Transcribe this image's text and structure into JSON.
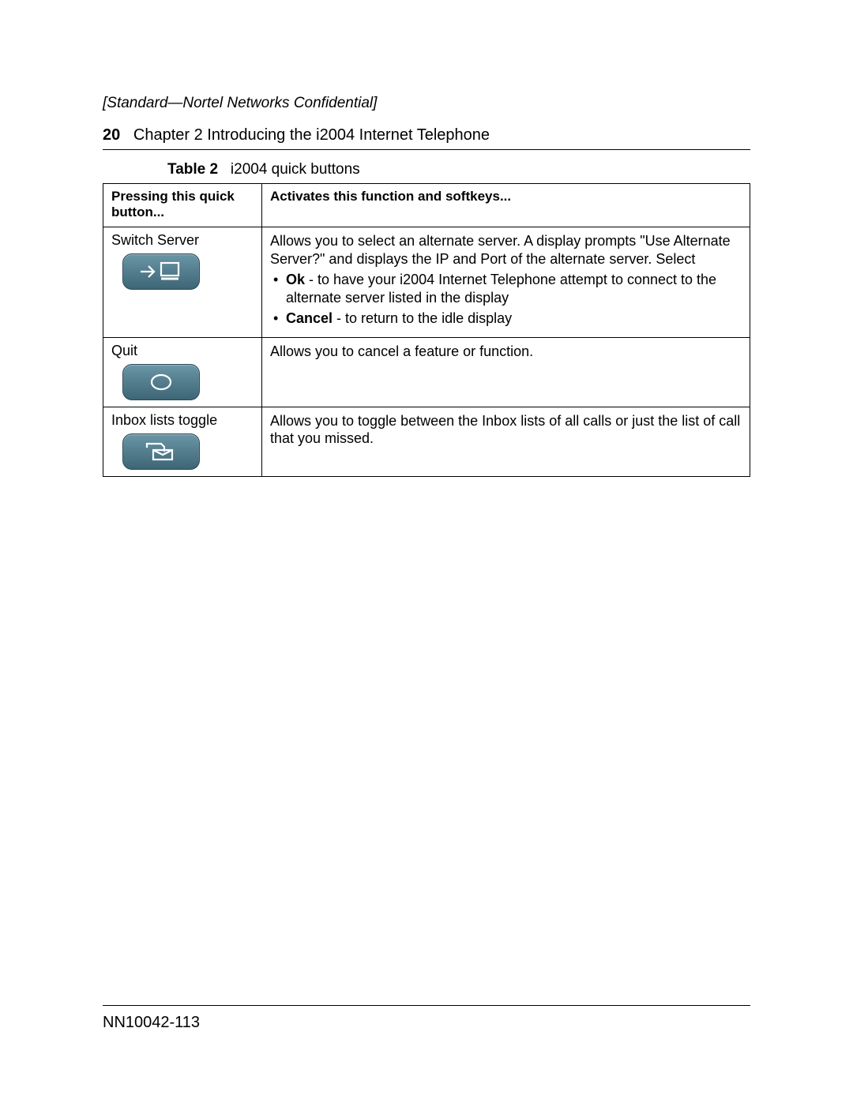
{
  "confidential": "[Standard—Nortel Networks Confidential]",
  "header": {
    "pageNumber": "20",
    "chapterLine": "Chapter 2  Introducing the i2004 Internet Telephone"
  },
  "tableCaption": {
    "label": "Table 2",
    "text": "i2004 quick buttons"
  },
  "tableHeaders": {
    "col1": "Pressing this quick button...",
    "col2": "Activates this function and softkeys..."
  },
  "rows": [
    {
      "name": "Switch Server",
      "icon": "switch-server-icon",
      "descIntro": "Allows you to select an alternate server. A display prompts \"Use Alternate Server?\" and displays the IP and Port of the alternate server. Select",
      "bullets": [
        {
          "bold": "Ok",
          "rest": " - to have your i2004 Internet Telephone attempt to connect to the alternate server listed in the display"
        },
        {
          "bold": "Cancel",
          "rest": " - to return to the idle display"
        }
      ]
    },
    {
      "name": "Quit",
      "icon": "quit-icon",
      "descIntro": "Allows you to cancel a feature or function.",
      "bullets": []
    },
    {
      "name": "Inbox lists toggle",
      "icon": "inbox-toggle-icon",
      "descIntro": "Allows you to toggle between the Inbox lists of all calls or just the list of call that you missed.",
      "bullets": []
    }
  ],
  "footer": {
    "docNumber": "NN10042-113"
  }
}
